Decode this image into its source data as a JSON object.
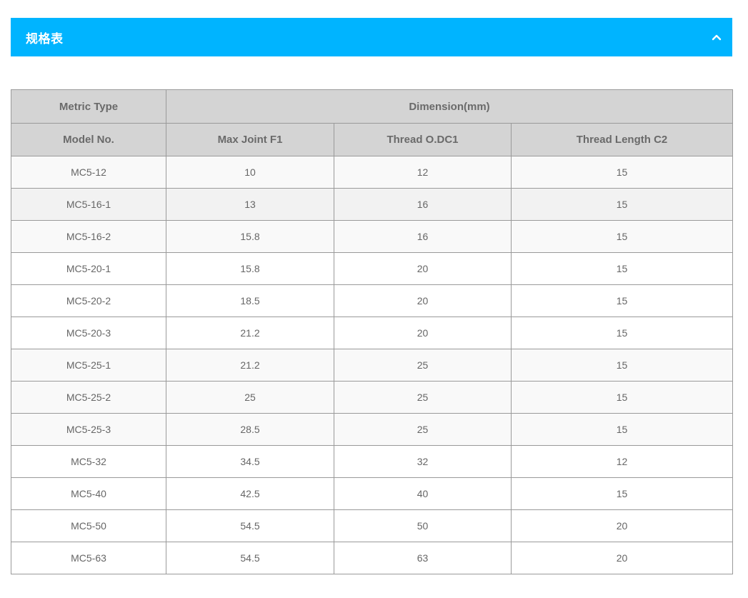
{
  "accordion": {
    "title": "规格表",
    "icon": "chevron-up-icon",
    "accent_color": "#00b4ff"
  },
  "table": {
    "group_header": {
      "type_label": "Metric Type",
      "dimension_label": "Dimension(mm)"
    },
    "columns": [
      "Model No.",
      "Max Joint F1",
      "Thread O.DC1",
      "Thread Length C2"
    ],
    "rows": [
      [
        "MC5-12",
        "10",
        "12",
        "15"
      ],
      [
        "MC5-16-1",
        "13",
        "16",
        "15"
      ],
      [
        "MC5-16-2",
        "15.8",
        "16",
        "15"
      ],
      [
        "MC5-20-1",
        "15.8",
        "20",
        "15"
      ],
      [
        "MC5-20-2",
        "18.5",
        "20",
        "15"
      ],
      [
        "MC5-20-3",
        "21.2",
        "20",
        "15"
      ],
      [
        "MC5-25-1",
        "21.2",
        "25",
        "15"
      ],
      [
        "MC5-25-2",
        "25",
        "25",
        "15"
      ],
      [
        "MC5-25-3",
        "28.5",
        "25",
        "15"
      ],
      [
        "MC5-32",
        "34.5",
        "32",
        "12"
      ],
      [
        "MC5-40",
        "42.5",
        "40",
        "15"
      ],
      [
        "MC5-50",
        "54.5",
        "50",
        "20"
      ],
      [
        "MC5-63",
        "54.5",
        "63",
        "20"
      ]
    ]
  }
}
